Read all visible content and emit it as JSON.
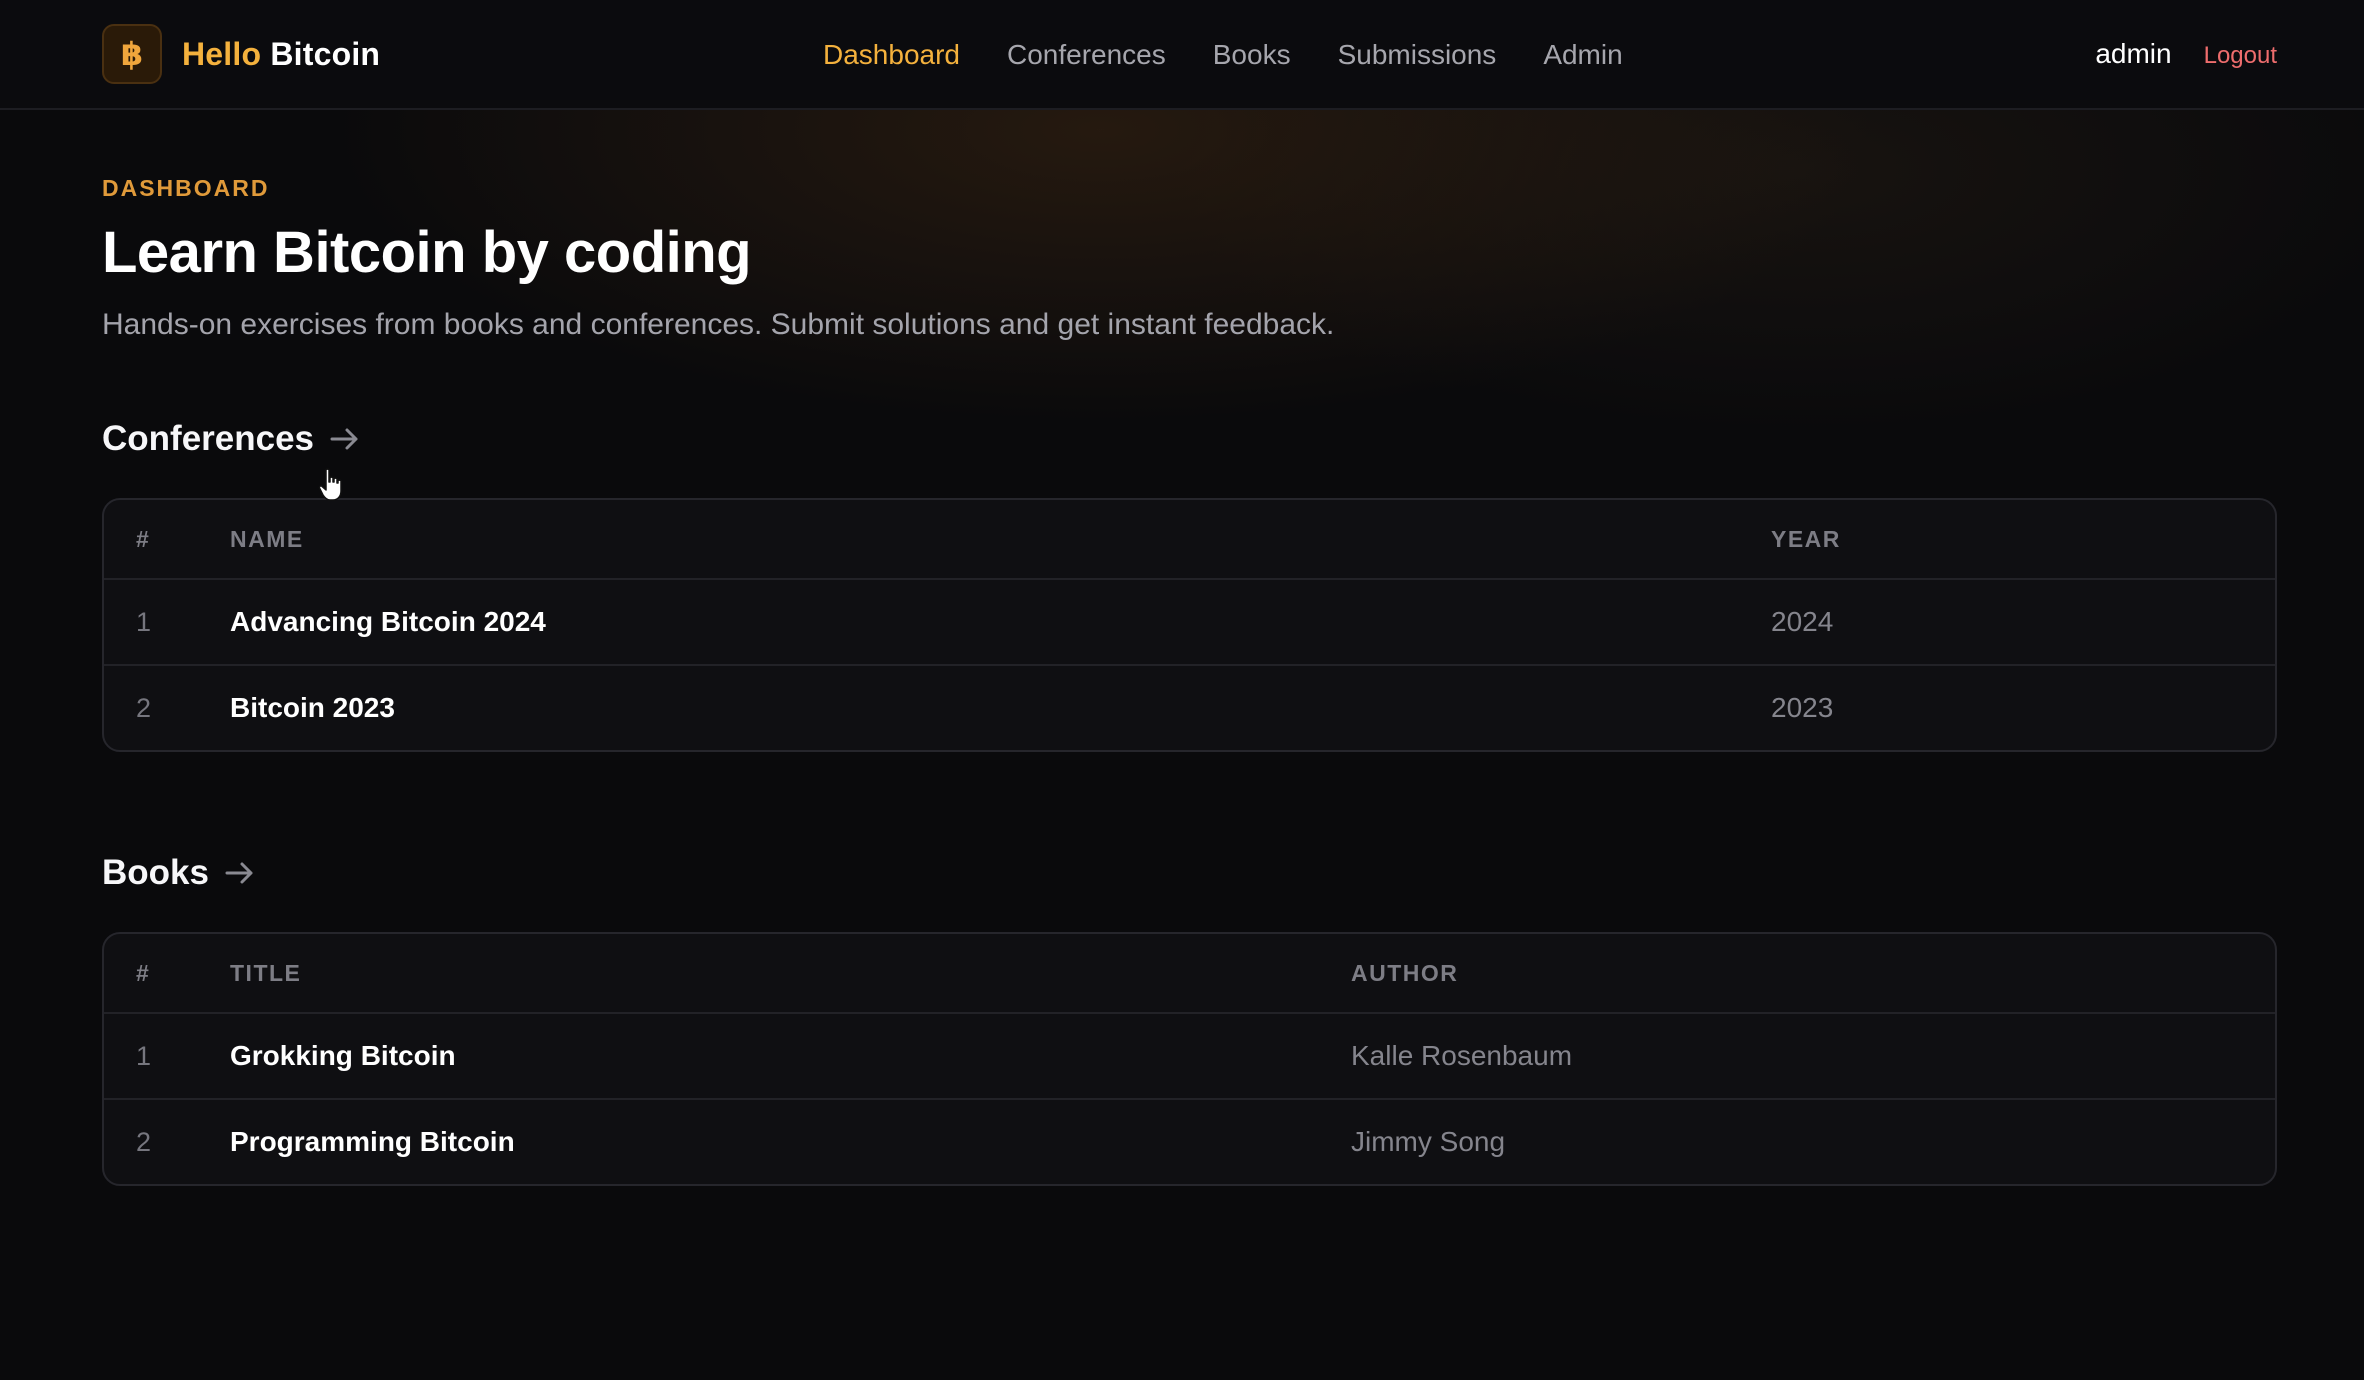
{
  "brand": {
    "logo_glyph": "฿",
    "hello": "Hello",
    "name": "Bitcoin",
    "accent_color": "#f4b13d"
  },
  "nav": {
    "items": [
      {
        "label": "Dashboard",
        "active": true
      },
      {
        "label": "Conferences",
        "active": false
      },
      {
        "label": "Books",
        "active": false
      },
      {
        "label": "Submissions",
        "active": false
      },
      {
        "label": "Admin",
        "active": false
      }
    ]
  },
  "user": {
    "name": "admin",
    "logout_label": "Logout",
    "logout_color": "#ee6d6d"
  },
  "page": {
    "eyebrow": "DASHBOARD",
    "title": "Learn Bitcoin by coding",
    "subtitle": "Hands-on exercises from books and conferences. Submit solutions and get instant feedback."
  },
  "conferences": {
    "title": "Conferences",
    "arrow_icon": "arrow-right-icon",
    "columns": [
      "#",
      "NAME",
      "YEAR"
    ],
    "rows": [
      {
        "num": "1",
        "name": "Advancing Bitcoin 2024",
        "year": "2024"
      },
      {
        "num": "2",
        "name": "Bitcoin 2023",
        "year": "2023"
      }
    ]
  },
  "books": {
    "title": "Books",
    "arrow_icon": "arrow-right-icon",
    "columns": [
      "#",
      "TITLE",
      "AUTHOR"
    ],
    "rows": [
      {
        "num": "1",
        "title": "Grokking Bitcoin",
        "author": "Kalle Rosenbaum"
      },
      {
        "num": "2",
        "title": "Programming Bitcoin",
        "author": "Jimmy Song"
      }
    ]
  }
}
